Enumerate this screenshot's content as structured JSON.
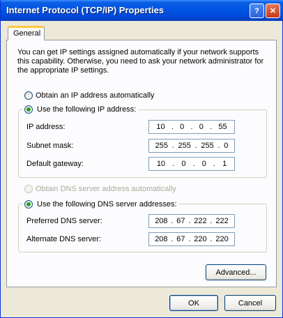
{
  "window": {
    "title": "Internet Protocol (TCP/IP) Properties",
    "help_glyph": "?",
    "close_glyph": "✕"
  },
  "tabs": [
    {
      "label": "General"
    }
  ],
  "intro": "You can get IP settings assigned automatically if your network supports this capability. Otherwise, you need to ask your network administrator for the appropriate IP settings.",
  "ip": {
    "auto_label": "Obtain an IP address automatically",
    "manual_label": "Use the following IP address:",
    "selected": "manual",
    "fields": [
      {
        "label": "IP address:",
        "octets": [
          "10",
          "0",
          "0",
          "55"
        ]
      },
      {
        "label": "Subnet mask:",
        "octets": [
          "255",
          "255",
          "255",
          "0"
        ]
      },
      {
        "label": "Default gateway:",
        "octets": [
          "10",
          "0",
          "0",
          "1"
        ]
      }
    ]
  },
  "dns": {
    "auto_label": "Obtain DNS server address automatically",
    "manual_label": "Use the following DNS server addresses:",
    "selected": "manual",
    "fields": [
      {
        "label": "Preferred DNS server:",
        "octets": [
          "208",
          "67",
          "222",
          "222"
        ]
      },
      {
        "label": "Alternate DNS server:",
        "octets": [
          "208",
          "67",
          "220",
          "220"
        ]
      }
    ]
  },
  "buttons": {
    "advanced": "Advanced...",
    "ok": "OK",
    "cancel": "Cancel"
  }
}
